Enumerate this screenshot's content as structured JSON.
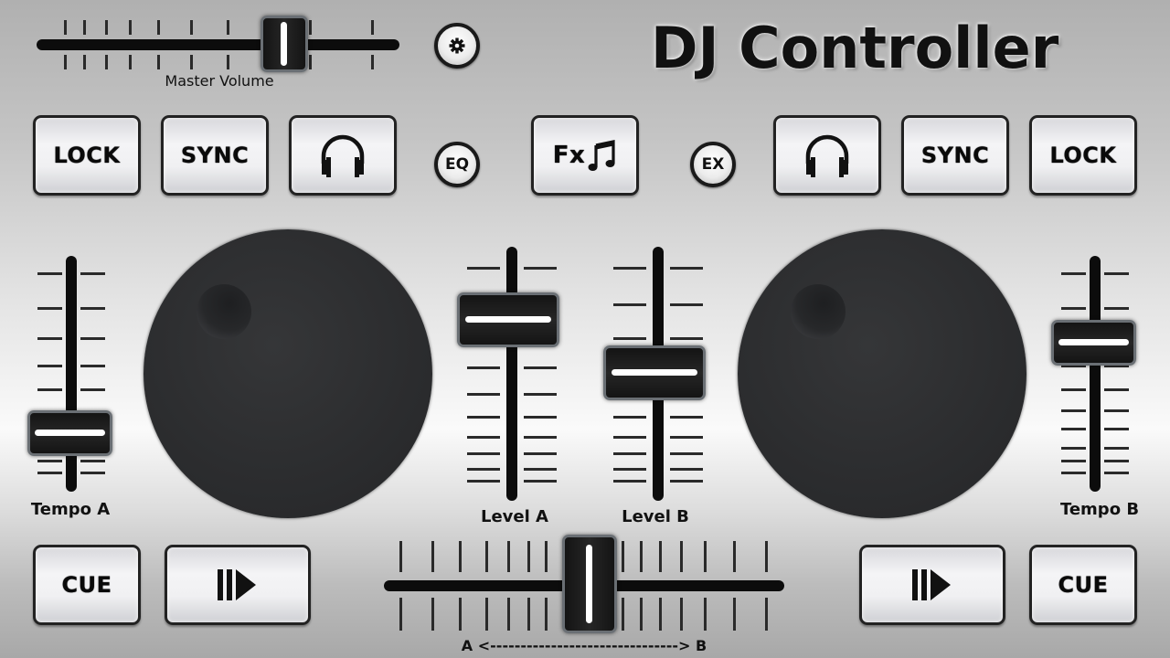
{
  "app": {
    "title": "DJ Controller"
  },
  "master_volume": {
    "label": "Master Volume",
    "value_fraction": 0.75
  },
  "settings_button": {
    "icon": "gear-icon"
  },
  "deck_a": {
    "lock_label": "LOCK",
    "sync_label": "SYNC",
    "headphones_icon": "headphones-icon",
    "cue_label": "CUE",
    "play_pause_icon": "play-pause-icon",
    "tempo_label": "Tempo A",
    "tempo_value_fraction": 0.33,
    "level_label": "Level A",
    "level_value_fraction": 0.78
  },
  "deck_b": {
    "lock_label": "LOCK",
    "sync_label": "SYNC",
    "headphones_icon": "headphones-icon",
    "cue_label": "CUE",
    "play_pause_icon": "play-pause-icon",
    "tempo_label": "Tempo B",
    "tempo_value_fraction": 0.77,
    "level_label": "Level B",
    "level_value_fraction": 0.52
  },
  "center": {
    "eq_label": "EQ",
    "fx_label": "Fx",
    "fx_icon": "music-note-icon",
    "ex_label": "EX"
  },
  "crossfader": {
    "label": "A <-------------------------------> B",
    "value_fraction": 0.5
  }
}
